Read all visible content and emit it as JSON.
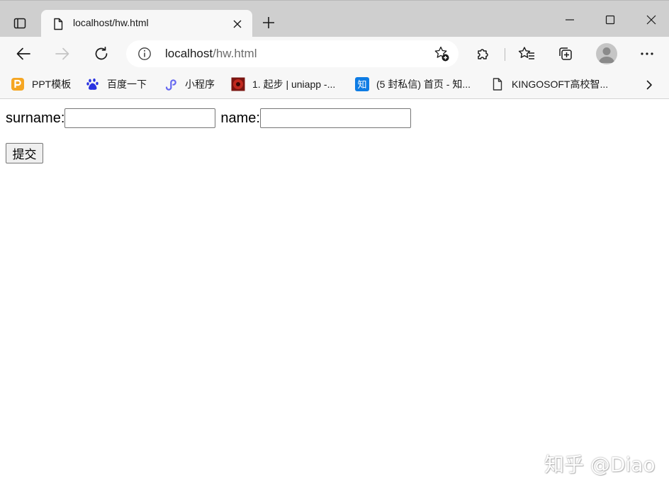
{
  "tab": {
    "title": "localhost/hw.html"
  },
  "toolbar": {
    "url_host": "localhost",
    "url_path": "/hw.html"
  },
  "bookmarks": [
    {
      "label": "PPT模板",
      "icon": "ppt-icon",
      "color": "#f5a623"
    },
    {
      "label": "百度一下",
      "icon": "baidu-paw-icon",
      "color": "#2932e1"
    },
    {
      "label": "小程序",
      "icon": "miniprogram-icon",
      "color": "#6467f0"
    },
    {
      "label": "1. 起步 | uniapp -...",
      "icon": "uniapp-icon",
      "color": "#c0281e"
    },
    {
      "label": "(5 封私信) 首页 - 知...",
      "icon": "zhihu-icon",
      "color": "#0e7ce4"
    },
    {
      "label": "KINGOSOFT高校智...",
      "icon": "page-icon",
      "color": "#333333"
    }
  ],
  "form": {
    "surname_label": "surname:",
    "surname_value": "",
    "name_label": "name:",
    "name_value": "",
    "submit_label": "提交"
  },
  "watermark": "知乎 @Diao"
}
